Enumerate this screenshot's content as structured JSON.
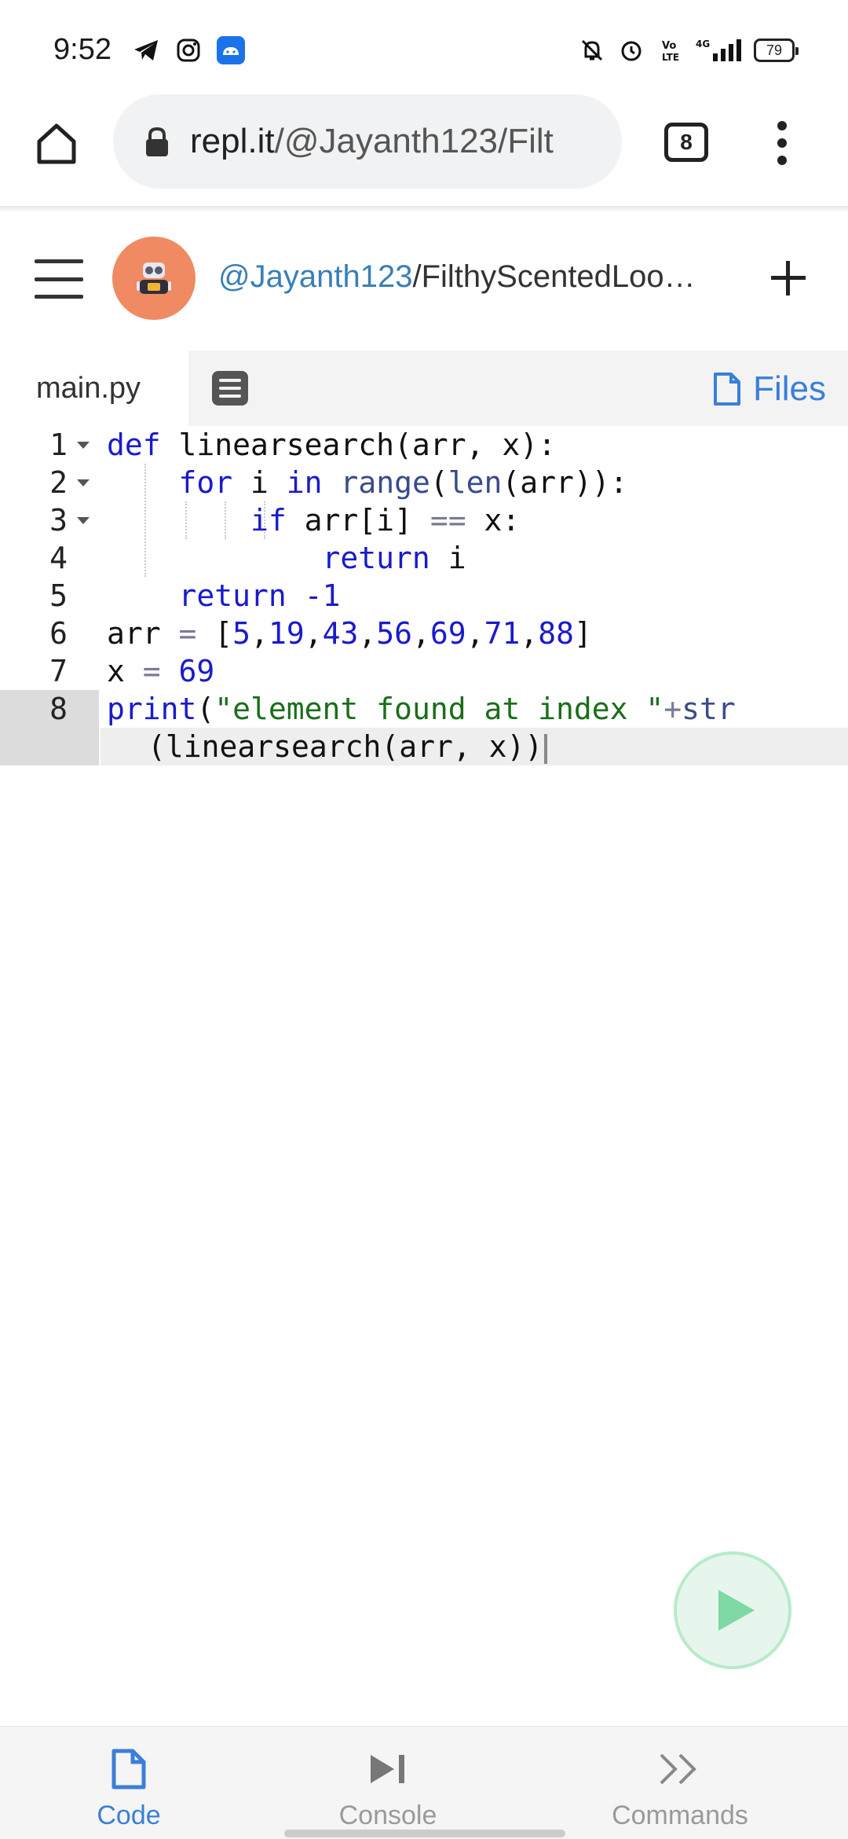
{
  "status_bar": {
    "time": "9:52",
    "left_icons": [
      "telegram-icon",
      "instagram-icon",
      "android-app-icon"
    ],
    "right_icons": [
      "notifications-off-icon",
      "alarm-icon",
      "volte-icon",
      "4g-signal-icon"
    ],
    "battery": "79"
  },
  "browser": {
    "url_host": "repl.it",
    "url_path": "/@Jayanth123/Filt",
    "tab_count": "8"
  },
  "repl": {
    "user": "@Jayanth123",
    "separator": "/",
    "name": "FilthyScentedLoo…"
  },
  "tabs": {
    "file": "main.py",
    "files_label": "Files"
  },
  "editor": {
    "line_numbers": [
      "1",
      "2",
      "3",
      "4",
      "5",
      "6",
      "7",
      "8"
    ],
    "active_line": 8
  },
  "bottom_nav": {
    "items": [
      {
        "label": "Code",
        "active": true
      },
      {
        "label": "Console",
        "active": false
      },
      {
        "label": "Commands",
        "active": false
      }
    ]
  },
  "colors": {
    "accent": "#3a7fd8",
    "run_button": "#7fd9a4",
    "avatar_bg": "#f08a62",
    "keyword": "#1a1acc",
    "string": "#1a6e1a"
  }
}
